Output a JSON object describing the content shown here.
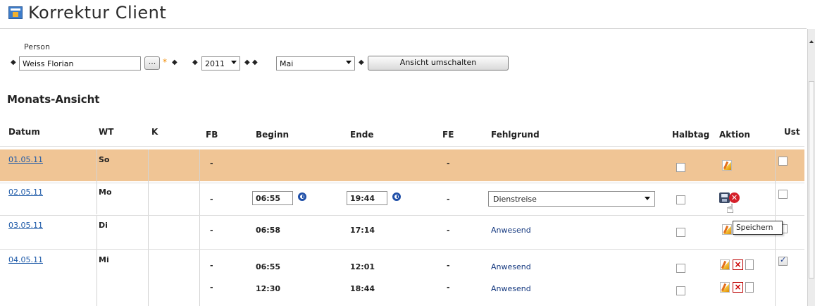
{
  "app": {
    "title": "Korrektur Client"
  },
  "form": {
    "person_label": "Person",
    "person_value": "Weiss Florian",
    "dots_label": "...",
    "required_marker": "*",
    "year_value": "2011",
    "month_value": "Mai",
    "switch_label": "Ansicht umschalten"
  },
  "section": {
    "title": "Monats-Ansicht"
  },
  "table": {
    "columns": [
      "Datum",
      "WT",
      "K",
      "FB",
      "Beginn",
      "Ende",
      "FE",
      "Fehlgrund",
      "Halbtag",
      "Aktion",
      "Ust"
    ],
    "rows": [
      {
        "date": "01.05.11",
        "wt": "So",
        "fb": "-",
        "fe": "-",
        "highlight": true
      },
      {
        "date": "02.05.11",
        "wt": "Mo",
        "fb": "-",
        "begin": "06:55",
        "end": "19:44",
        "fe": "-",
        "reason": "Dienstreise"
      },
      {
        "date": "03.05.11",
        "wt": "Di",
        "fb": "-",
        "begin": "06:58",
        "end": "17:14",
        "fe": "-",
        "reason": "Anwesend"
      },
      {
        "date": "04.05.11",
        "wt": "Mi",
        "lines": [
          {
            "fb": "-",
            "begin": "06:55",
            "end": "12:01",
            "fe": "-",
            "reason": "Anwesend"
          },
          {
            "fb": "-",
            "begin": "12:30",
            "end": "18:44",
            "fe": "-",
            "reason": "Anwesend"
          }
        ],
        "ust_checked": true
      }
    ]
  },
  "tooltip": {
    "text": "Speichern"
  },
  "colors": {
    "highlight": "#f0c595",
    "link": "#1e5aa8"
  }
}
